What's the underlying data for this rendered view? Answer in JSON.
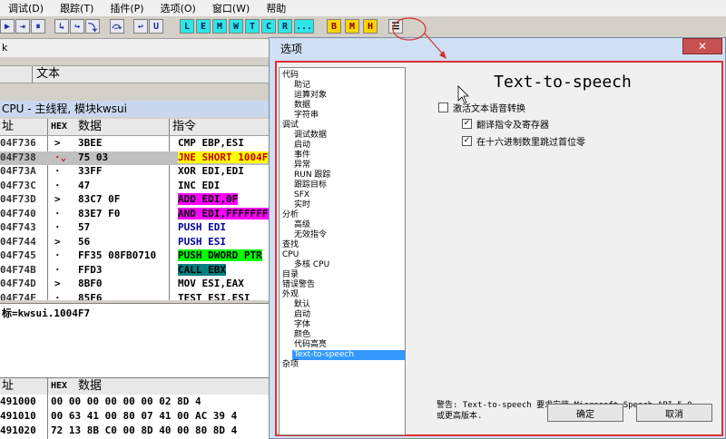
{
  "menu": [
    "调试(D)",
    "跟踪(T)",
    "插件(P)",
    "选项(O)",
    "窗口(W)",
    "帮助"
  ],
  "toolbar": {
    "nav_icons": [
      "play-icon",
      "step-icon",
      "pause-icon",
      "step-into-icon",
      "step-over-icon",
      "trace-into-icon",
      "trace-over-icon",
      "execute-till-return-icon",
      "execute-till-user-icon"
    ],
    "nav_glyphs": [
      "▶",
      "⇥",
      "⏸",
      "↳",
      "↪",
      "⤵",
      "⤼",
      "↩",
      "U"
    ],
    "view_buttons": [
      "L",
      "E",
      "M",
      "W",
      "T",
      "C",
      "R",
      "..."
    ],
    "bp_buttons": [
      "B",
      "M",
      "H"
    ],
    "list_glyph": "☰"
  },
  "subwindow": {
    "title_fragment": "k",
    "header_text": "文本"
  },
  "cpu": {
    "title": "CPU - 主线程, 模块kwsui",
    "col_addr": "址",
    "col_hex": "HEX",
    "col_data": "数据",
    "col_instr": "指令",
    "rows": [
      {
        "addr": "04F736",
        "mark": ">",
        "hex": "3BEE",
        "instr": "CMP EBP,ESI"
      },
      {
        "addr": "04F738",
        "mark": "·⌄",
        "hex": "75 03",
        "instr": "JNE SHORT 1004F"
      },
      {
        "addr": "04F73A",
        "mark": "·",
        "hex": "33FF",
        "instr": "XOR EDI,EDI"
      },
      {
        "addr": "04F73C",
        "mark": "·",
        "hex": "47",
        "instr": "INC EDI"
      },
      {
        "addr": "04F73D",
        "mark": ">",
        "hex": "83C7 0F",
        "instr": "ADD EDI,0F"
      },
      {
        "addr": "04F740",
        "mark": "·",
        "hex": "83E7 F0",
        "instr": "AND EDI,FFFFFFF0"
      },
      {
        "addr": "04F743",
        "mark": "·",
        "hex": "57",
        "instr": "PUSH EDI"
      },
      {
        "addr": "04F744",
        "mark": ">",
        "hex": "56",
        "instr": "PUSH ESI"
      },
      {
        "addr": "04F745",
        "mark": "·",
        "hex": "FF35 08FB0710",
        "instr": "PUSH DWORD PTR"
      },
      {
        "addr": "04F74B",
        "mark": "·",
        "hex": "FFD3",
        "instr": "CALL EBX"
      },
      {
        "addr": "04F74D",
        "mark": ">",
        "hex": "8BF0",
        "instr": "MOV ESI,EAX"
      },
      {
        "addr": "04F74F",
        "mark": "·",
        "hex": "85F6",
        "instr": "TEST ESI,ESI"
      }
    ],
    "info": "标=kwsui.1004F7"
  },
  "dump": {
    "col_addr": "址",
    "col_hex": "HEX",
    "col_data": "数据",
    "rows": [
      {
        "addr": "491000",
        "bytes": "00 00 00 00 00 00 02 8D 4"
      },
      {
        "addr": "491010",
        "bytes": "00 63 41 00 80 07 41 00 AC 39 4"
      },
      {
        "addr": "491020",
        "bytes": "72 13 8B C0 00 8D 40 00 80 8D 4"
      }
    ]
  },
  "dialog": {
    "title": "选项",
    "close": "✕",
    "tree": [
      {
        "label": "代码",
        "level": 0
      },
      {
        "label": "助记",
        "level": 1
      },
      {
        "label": "运算对象",
        "level": 1
      },
      {
        "label": "数据",
        "level": 1
      },
      {
        "label": "字符串",
        "level": 1
      },
      {
        "label": "调试",
        "level": 0
      },
      {
        "label": "调试数据",
        "level": 1
      },
      {
        "label": "启动",
        "level": 1
      },
      {
        "label": "事件",
        "level": 1
      },
      {
        "label": "异常",
        "level": 1
      },
      {
        "label": "RUN 跟踪",
        "level": 1
      },
      {
        "label": "跟踪目标",
        "level": 1
      },
      {
        "label": "SFX",
        "level": 1
      },
      {
        "label": "实时",
        "level": 1
      },
      {
        "label": "分析",
        "level": 0
      },
      {
        "label": "高级",
        "level": 1
      },
      {
        "label": "无效指令",
        "level": 1
      },
      {
        "label": "查找",
        "level": 0
      },
      {
        "label": "CPU",
        "level": 0
      },
      {
        "label": "多核 CPU",
        "level": 1
      },
      {
        "label": "目录",
        "level": 0
      },
      {
        "label": "错误警告",
        "level": 0
      },
      {
        "label": "外观",
        "level": 0
      },
      {
        "label": "默认",
        "level": 1
      },
      {
        "label": "启动",
        "level": 1
      },
      {
        "label": "字体",
        "level": 1
      },
      {
        "label": "颜色",
        "level": 1
      },
      {
        "label": "代码高亮",
        "level": 1
      },
      {
        "label": "Text-to-speech",
        "level": 1,
        "selected": true
      },
      {
        "label": "杂项",
        "level": 0
      }
    ],
    "panel": {
      "title": "Text-to-speech",
      "checkboxes": [
        {
          "label": "激活文本语音转换",
          "checked": false
        },
        {
          "label": "翻译指令及寄存器",
          "checked": true
        },
        {
          "label": "在十六进制数里跳过首位零",
          "checked": true
        }
      ],
      "warning": "警告: Text-to-speech 要求安装 Microsoft Speech API 5.0\n或更高版本.",
      "ok": "确定",
      "cancel": "取消"
    }
  }
}
